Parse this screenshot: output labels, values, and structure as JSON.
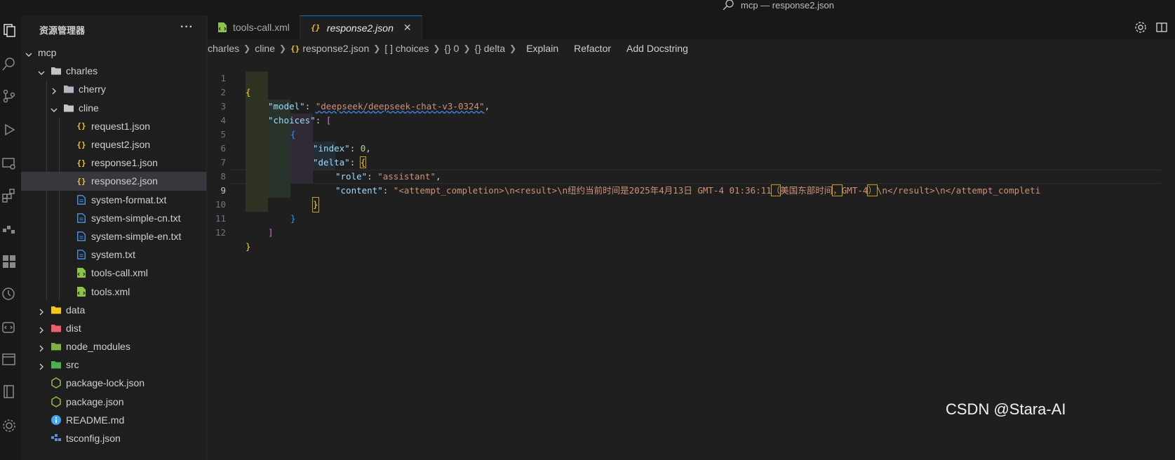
{
  "window": {
    "title": "mcp — response2.json"
  },
  "sidebar": {
    "title": "资源管理器",
    "more": "···",
    "tree": [
      {
        "label": "mcp",
        "type": "folder-open",
        "depth": 0
      },
      {
        "label": "charles",
        "type": "folder-open",
        "depth": 1
      },
      {
        "label": "cherry",
        "type": "folder-closed",
        "depth": 2
      },
      {
        "label": "cline",
        "type": "folder-open",
        "depth": 2
      },
      {
        "label": "request1.json",
        "type": "json",
        "depth": 3
      },
      {
        "label": "request2.json",
        "type": "json",
        "depth": 3
      },
      {
        "label": "response1.json",
        "type": "json",
        "depth": 3
      },
      {
        "label": "response2.json",
        "type": "json",
        "depth": 3,
        "selected": true
      },
      {
        "label": "system-format.txt",
        "type": "txt",
        "depth": 3
      },
      {
        "label": "system-simple-cn.txt",
        "type": "txt",
        "depth": 3
      },
      {
        "label": "system-simple-en.txt",
        "type": "txt",
        "depth": 3
      },
      {
        "label": "system.txt",
        "type": "txt",
        "depth": 3
      },
      {
        "label": "tools-call.xml",
        "type": "xml",
        "depth": 3
      },
      {
        "label": "tools.xml",
        "type": "xml",
        "depth": 3
      },
      {
        "label": "data",
        "type": "folder-data",
        "depth": 1
      },
      {
        "label": "dist",
        "type": "folder-dist",
        "depth": 1
      },
      {
        "label": "node_modules",
        "type": "folder-node",
        "depth": 1
      },
      {
        "label": "src",
        "type": "folder-src",
        "depth": 1
      },
      {
        "label": "package-lock.json",
        "type": "npm",
        "depth": 1
      },
      {
        "label": "package.json",
        "type": "npm",
        "depth": 1
      },
      {
        "label": "README.md",
        "type": "info",
        "depth": 1
      },
      {
        "label": "tsconfig.json",
        "type": "ts",
        "depth": 1
      }
    ]
  },
  "tabs": [
    {
      "label": "tools-call.xml",
      "active": false
    },
    {
      "label": "response2.json",
      "active": true,
      "close": "✕"
    }
  ],
  "breadcrumbs": {
    "items": [
      "charles",
      "cline",
      "response2.json",
      "[ ] choices",
      "{} 0",
      "{} delta"
    ],
    "actions": [
      "Explain",
      "Refactor",
      "Add Docstring"
    ]
  },
  "code": {
    "current_line": 9,
    "line_numbers": [
      "1",
      "2",
      "3",
      "4",
      "5",
      "6",
      "7",
      "8",
      "9",
      "10",
      "11",
      "12"
    ],
    "model_key": "\"model\"",
    "model_value": "\"deepseek/deepseek-chat-v3-0324\"",
    "choices_key": "\"choices\"",
    "index_key": "\"index\"",
    "index_value": "0",
    "delta_key": "\"delta\"",
    "role_key": "\"role\"",
    "role_value": "\"assistant\"",
    "content_key": "\"content\"",
    "content_value_1": "\"<attempt_completion>\\n<result>\\n纽约当前时间是2025年4月13日 GMT-4 01:36:11",
    "content_value_2": "（",
    "content_value_3": "美国东部时间",
    "content_value_4": "，",
    "content_value_5": "GMT-4",
    "content_value_6": "）",
    "content_value_7": "\\n</result>\\n</attempt_completi"
  },
  "watermark": "CSDN @Stara-AI"
}
